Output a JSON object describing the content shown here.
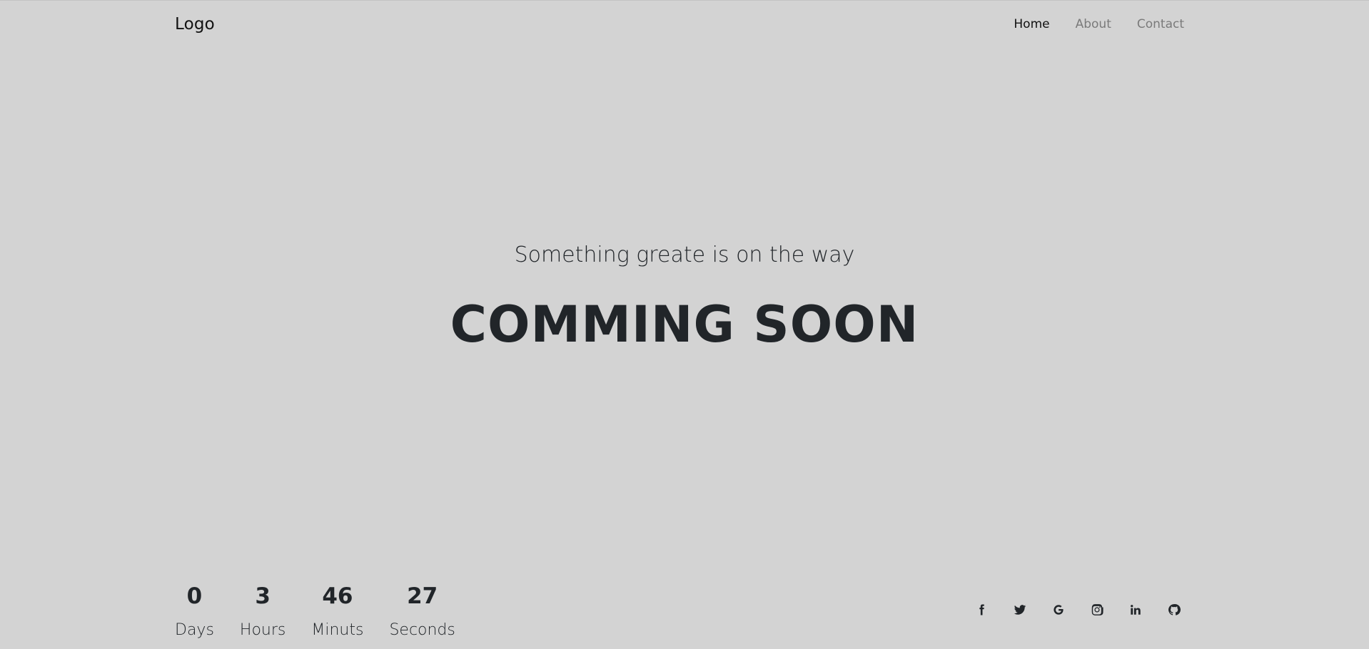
{
  "navbar": {
    "logo": "Logo",
    "links": [
      {
        "label": "Home",
        "active": true
      },
      {
        "label": "About",
        "active": false
      },
      {
        "label": "Contact",
        "active": false
      }
    ]
  },
  "hero": {
    "subtitle": "Something greate is on the way",
    "headline": "COMMING SOON"
  },
  "countdown": {
    "units": [
      {
        "value": "0",
        "label": "Days"
      },
      {
        "value": "3",
        "label": "Hours"
      },
      {
        "value": "46",
        "label": "Minuts"
      },
      {
        "value": "27",
        "label": "Seconds"
      }
    ]
  },
  "social": {
    "icons": [
      "facebook-icon",
      "twitter-icon",
      "google-icon",
      "instagram-icon",
      "linkedin-icon",
      "github-icon"
    ]
  },
  "colors": {
    "background": "#d3d3d3",
    "text": "#212529",
    "nav_inactive": "#7a7a7a"
  }
}
